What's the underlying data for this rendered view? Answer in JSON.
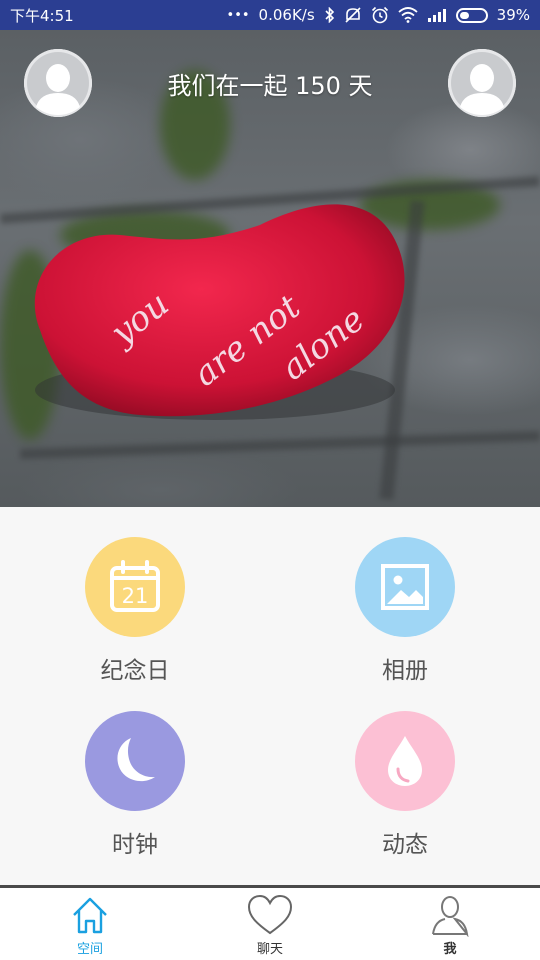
{
  "status_bar": {
    "time": "下午4:51",
    "dots": "•••",
    "network_speed": "0.06K/s",
    "battery_percent": "39%",
    "battery_level": 0.39,
    "icons": [
      "bluetooth-icon",
      "mute-icon",
      "alarm-icon",
      "wifi-icon",
      "signal-icon",
      "battery-icon"
    ]
  },
  "hero": {
    "together_text": "我们在一起 150 天",
    "image_text": [
      "you",
      "are not",
      "alone"
    ],
    "heart_color": "#d4163a"
  },
  "menu": {
    "items": [
      {
        "label": "纪念日",
        "icon": "calendar-icon",
        "color": "#fbd97c",
        "calendar_day": "21"
      },
      {
        "label": "相册",
        "icon": "photo-icon",
        "color": "#9fd6f5"
      },
      {
        "label": "时钟",
        "icon": "moon-icon",
        "color": "#9a99e0"
      },
      {
        "label": "动态",
        "icon": "drop-icon",
        "color": "#fcc0d4"
      }
    ]
  },
  "bottom_nav": {
    "items": [
      {
        "label": "空间",
        "icon": "home-icon",
        "active": true
      },
      {
        "label": "聊天",
        "icon": "heart-icon",
        "active": false
      },
      {
        "label": "我",
        "icon": "person-icon",
        "active": false
      }
    ],
    "active_color": "#1aa0e0"
  }
}
